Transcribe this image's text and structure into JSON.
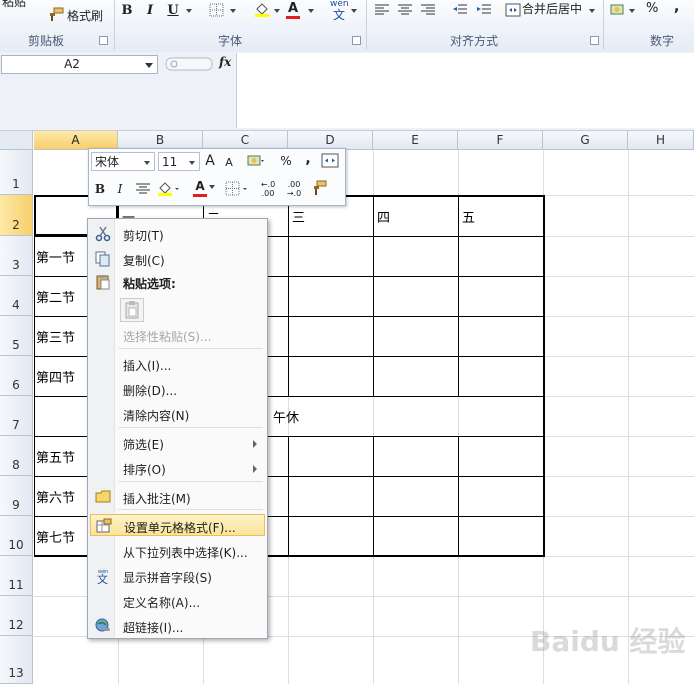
{
  "ribbon": {
    "clipboard": {
      "paste_partial": "粘贴",
      "format_painter": "格式刷",
      "group_label": "剪贴板"
    },
    "font": {
      "bold": "B",
      "italic": "I",
      "underline": "U",
      "font_color_letter": "A",
      "phonetic_top": "wén",
      "phonetic_char": "文",
      "group_label": "字体"
    },
    "alignment": {
      "merge_center": "合并后居中",
      "group_label": "对齐方式"
    },
    "number": {
      "percent": "%",
      "comma": ",",
      "group_label": "数字"
    }
  },
  "formula_bar": {
    "name_box": "A2",
    "fx_label": "fx",
    "content": ""
  },
  "columns": [
    "A",
    "B",
    "C",
    "D",
    "E",
    "F",
    "G",
    "H"
  ],
  "rows": [
    "1",
    "2",
    "3",
    "4",
    "5",
    "6",
    "7",
    "8",
    "9",
    "10",
    "11",
    "12",
    "13"
  ],
  "selected_cell": "A2",
  "cells": {
    "header_row": [
      "",
      "一",
      "二",
      "三",
      "四",
      "五"
    ],
    "periods": [
      "第一节",
      "第二节",
      "第三节",
      "第四节",
      "午休",
      "第五节",
      "第六节",
      "第七节"
    ]
  },
  "mini_toolbar": {
    "font_name": "宋体",
    "font_size": "11",
    "grow_font": "A",
    "shrink_font": "A",
    "percent": "%",
    "comma": ",",
    "bold": "B",
    "italic": "I",
    "font_color_letter": "A",
    "inc_decimal": "←.0 .00",
    "dec_decimal": ".00 →.0"
  },
  "context_menu": {
    "items": [
      {
        "label": "剪切(T)",
        "icon": "scissors-icon",
        "enabled": true
      },
      {
        "label": "复制(C)",
        "icon": "copy-icon",
        "enabled": true
      },
      {
        "label": "粘贴选项:",
        "icon": "paste-icon",
        "enabled": true,
        "bold": true
      },
      {
        "label": "",
        "icon": "paste-option-icon",
        "enabled": true
      },
      {
        "label": "选择性粘贴(S)...",
        "icon": "",
        "enabled": false
      },
      {
        "label": "插入(I)...",
        "icon": "",
        "enabled": true
      },
      {
        "label": "删除(D)...",
        "icon": "",
        "enabled": true
      },
      {
        "label": "清除内容(N)",
        "icon": "",
        "enabled": true
      },
      {
        "label": "筛选(E)",
        "icon": "",
        "enabled": true,
        "submenu": true
      },
      {
        "label": "排序(O)",
        "icon": "",
        "enabled": true,
        "submenu": true
      },
      {
        "label": "插入批注(M)",
        "icon": "comment-icon",
        "enabled": true
      },
      {
        "label": "设置单元格格式(F)...",
        "icon": "format-cells-icon",
        "enabled": true,
        "highlighted": true
      },
      {
        "label": "从下拉列表中选择(K)...",
        "icon": "",
        "enabled": true
      },
      {
        "label": "显示拼音字段(S)",
        "icon": "phonetic-icon",
        "enabled": true
      },
      {
        "label": "定义名称(A)...",
        "icon": "",
        "enabled": true
      },
      {
        "label": "超链接(I)...",
        "icon": "hyperlink-icon",
        "enabled": true
      }
    ]
  },
  "colors": {
    "selection": "#f8cf6b",
    "menu_highlight": "#fbe49a",
    "grid": "#dadfe6"
  },
  "watermark": "Baidu 经验"
}
